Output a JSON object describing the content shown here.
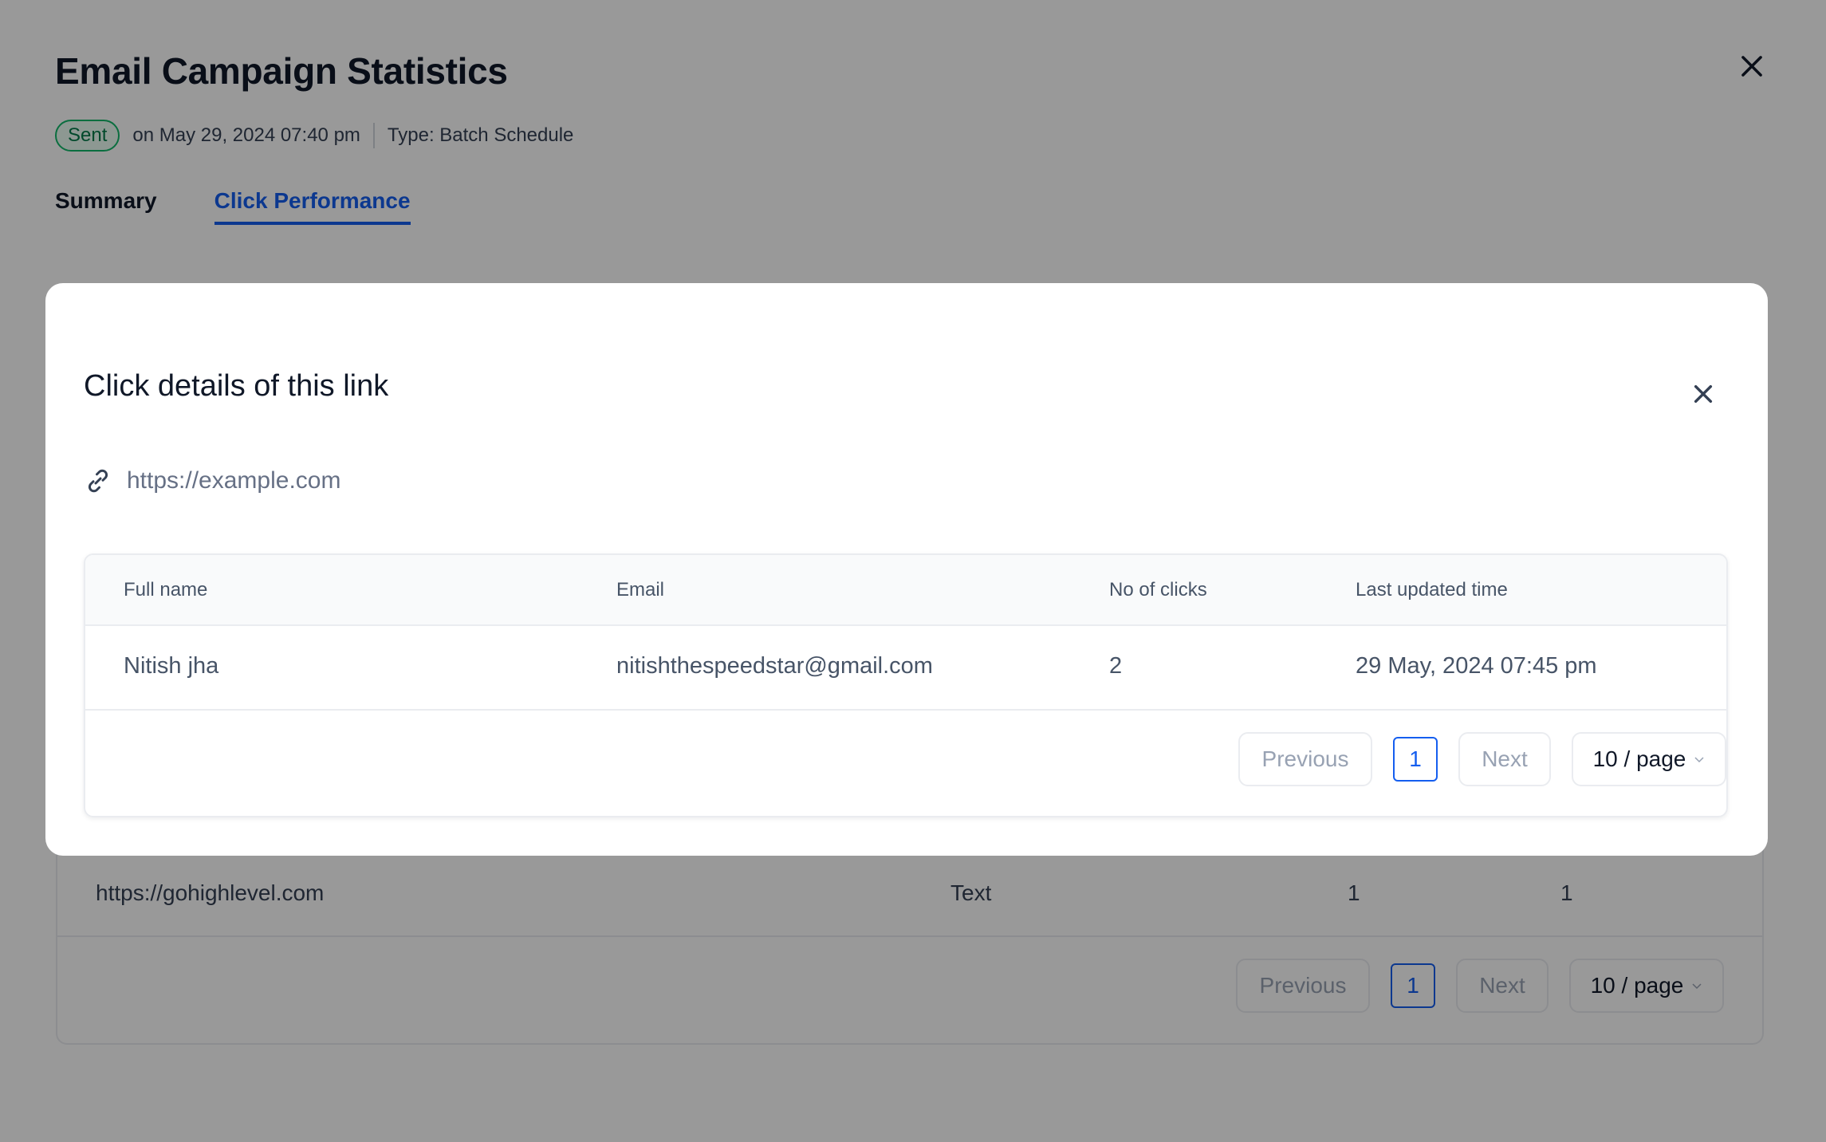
{
  "page": {
    "title": "Email Campaign Statistics",
    "status_badge": "Sent",
    "sent_on": "on May 29, 2024 07:40 pm",
    "type": "Type: Batch Schedule",
    "tabs": [
      {
        "label": "Summary",
        "active": false
      },
      {
        "label": "Click Performance",
        "active": true
      }
    ],
    "links_table": {
      "rows": [
        {
          "url": "https://gohighlevel.com",
          "type": "Text",
          "total_clicks": "1",
          "unique_clicks": "1"
        }
      ],
      "pagination": {
        "previous": "Previous",
        "current_page": "1",
        "next": "Next",
        "page_size": "10 / page"
      }
    }
  },
  "modal": {
    "title": "Click details of this link",
    "link_url": "https://example.com",
    "table": {
      "columns": [
        "Full name",
        "Email",
        "No of clicks",
        "Last updated time"
      ],
      "rows": [
        {
          "full_name": "Nitish jha",
          "email": "nitishthespeedstar@gmail.com",
          "clicks": "2",
          "last_updated": "29 May, 2024 07:45 pm"
        }
      ]
    },
    "pagination": {
      "previous": "Previous",
      "current_page": "1",
      "next": "Next",
      "page_size": "10 / page"
    }
  },
  "colors": {
    "accent": "#155EEF",
    "success": "#12B76A",
    "overlay": "rgba(0,0,0,0.4)"
  }
}
